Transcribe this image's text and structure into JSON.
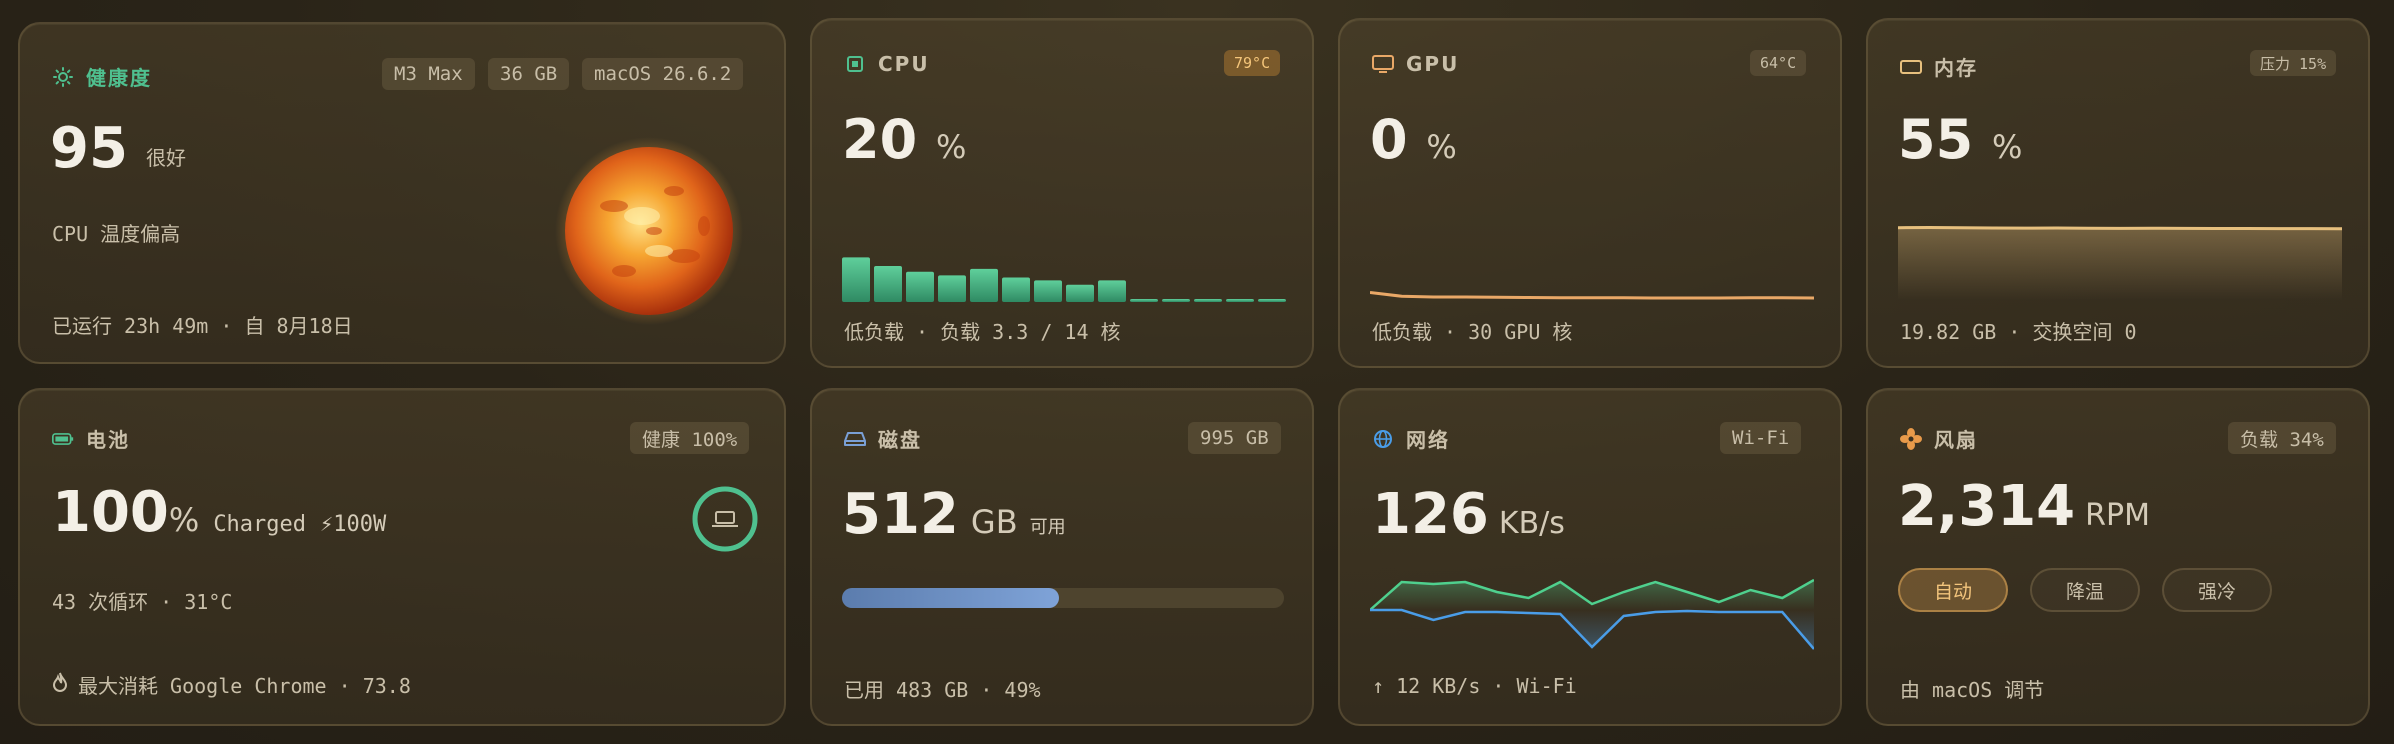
{
  "health": {
    "title": "健康度",
    "chips": [
      "M3 Max",
      "36 GB",
      "macOS 26.6.2"
    ],
    "score": "95",
    "score_label": "很好",
    "warning": "CPU 温度偏高",
    "uptime": "已运行 23h 49m · 自 8月18日",
    "icon": "sun-icon"
  },
  "cpu": {
    "title": "CPU",
    "temp": "79°C",
    "value": "20",
    "unit": "%",
    "footer": "低负载 · 负载 3.3 / 14 核",
    "core_loads": [
      0.62,
      0.5,
      0.42,
      0.37,
      0.46,
      0.34,
      0.3,
      0.24,
      0.3,
      0.04,
      0.04,
      0.04,
      0.04,
      0.04
    ],
    "color": "#4fb98a"
  },
  "gpu": {
    "title": "GPU",
    "temp": "64°C",
    "value": "0",
    "unit": "%",
    "footer": "低负载 · 30 GPU 核",
    "history": [
      3,
      1.5,
      1.2,
      1.2,
      1.1,
      1.0,
      0.9,
      0.9,
      0.9,
      0.8,
      0.8,
      0.8,
      0.9,
      0.9,
      0.8
    ],
    "color": "#e9a867"
  },
  "memory": {
    "title": "内存",
    "pressure": "压力 15%",
    "value": "55",
    "unit": "%",
    "footer": "19.82 GB · 交换空间 0",
    "history": [
      56,
      56.2,
      56,
      55.8,
      55.7,
      55.8,
      55.6,
      55.5,
      55.6,
      55.5,
      55.4,
      55.4,
      55.3,
      55.3,
      55.2
    ],
    "color": "#e7c07e"
  },
  "battery": {
    "title": "电池",
    "health": "健康 100%",
    "value": "100",
    "unit": "%",
    "state": "Charged",
    "power": "⚡100W",
    "cycles": "43 次循环 · 31°C",
    "top_consumer": "最大消耗 Google Chrome · 73.8",
    "level": 1.0,
    "color": "#4fb98a"
  },
  "disk": {
    "title": "磁盘",
    "total": "995 GB",
    "value": "512",
    "unit": "GB",
    "unit_label": "可用",
    "footer": "已用 483 GB · 49%",
    "used_fraction": 0.49,
    "color": "#6f8fbf"
  },
  "network": {
    "title": "网络",
    "iface": "Wi-Fi",
    "value": "126",
    "unit": "KB/s",
    "footer": "↑ 12 KB/s · Wi-Fi",
    "down": [
      0,
      28,
      26,
      28,
      18,
      12,
      28,
      6,
      18,
      28,
      18,
      8,
      20,
      12,
      30
    ],
    "up": [
      0,
      0,
      10,
      2,
      2,
      3,
      4,
      3,
      6,
      2,
      1,
      2,
      2,
      2,
      3
    ],
    "up2": [
      0,
      0,
      0,
      0,
      0,
      0,
      0,
      34,
      0,
      0,
      0,
      0,
      0,
      0,
      36
    ],
    "down_color": "#4fd08e",
    "up_color": "#4a9de8"
  },
  "fan": {
    "title": "风扇",
    "load": "负载 34%",
    "value": "2,314",
    "unit": "RPM",
    "modes": [
      "自动",
      "降温",
      "强冷"
    ],
    "active_mode": 0,
    "footer": "由 macOS 调节",
    "color": "#e89a4a"
  }
}
